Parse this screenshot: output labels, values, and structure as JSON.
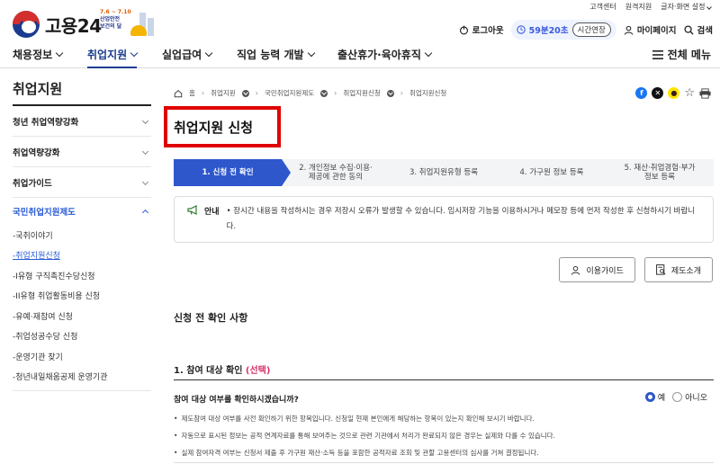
{
  "util": [
    "고객센터",
    "원격지원",
    "글자·화면 설정"
  ],
  "logo": {
    "text": "고용24",
    "promo_dates": "7.6 ~ 7.10",
    "promo_line1": "산업안전",
    "promo_line2": "보건의 달"
  },
  "header": {
    "logout": "로그아웃",
    "timer": "59분20초",
    "extend": "시간연장",
    "mypage": "마이페이지",
    "search": "검색"
  },
  "gnb": {
    "items": [
      "채용정보",
      "취업지원",
      "실업급여",
      "직업 능력 개발",
      "출산휴가·육아휴직"
    ],
    "active_index": 1,
    "all_menu": "전체 메뉴"
  },
  "sidebar": {
    "title": "취업지원",
    "sections": [
      "청년 취업역량강화",
      "취업역량강화",
      "취업가이드"
    ],
    "open_section": "국민취업지원제도",
    "subitems": [
      "-국취이야기",
      "-취업지원신청",
      "-I유형 구직촉진수당신청",
      "-II유형 취업활동비용 신청",
      "-유예·재참여 신청",
      "-취업성공수당 신청",
      "-운영기관 찾기",
      "-청년내일채움공제 운영기관"
    ],
    "active_sub_index": 1
  },
  "breadcrumb": [
    "홈",
    "취업지원",
    "국민취업지원제도",
    "취업지원신청",
    "취업지원신청"
  ],
  "page_title": "취업지원 신청",
  "steps": [
    "1. 신청 전 확인",
    "2. 개인정보 수집·이용·\n제공에 관한 동의",
    "3. 취업지원유형 등록",
    "4. 가구원 정보 등록",
    "5. 재산·취업경험·부가\n정보 등록"
  ],
  "notice": {
    "label": "안내",
    "text": "• 장시간 내용을 작성하시는 경우 저장시 오류가 발생할 수 있습니다. 임시저장 기능을 이용하시거나 메모장 등에 먼저 작성한 후 신청하시기 바랍니다."
  },
  "buttons": {
    "guide": "이용가이드",
    "intro": "제도소개"
  },
  "section_title": "신청 전 확인 사항",
  "subsection": {
    "title": "1. 참여 대상 확인 ",
    "accent": "(선택)"
  },
  "question": "참여 대상 여부를 확인하시겠습니까?",
  "radios": {
    "yes": "예",
    "no": "아니오",
    "selected": "yes"
  },
  "bullets": [
    "제도참여 대상 여부를 사전 확인하기 위한 항목입니다. 신청일 현재 본인에게 해당하는 항목이 있는지 확인해 보시기 바랍니다.",
    "자동으로 표시된 정보는 공적 연계자료를 통해 보여주는 것으로 관련 기관에서 처리가 완료되지 않은 경우는 실제와 다를 수 있습니다.",
    "실제 참여자격 여부는 신청서 제출 후 가구원 재산·소득 등을 포함한 공적자료 조회 및 관할 고용센터의 심사를 거쳐 결정됩니다."
  ],
  "colors": {
    "primary": "#2e57cc",
    "highlight_box": "#e00000",
    "accent": "#d6336c"
  }
}
